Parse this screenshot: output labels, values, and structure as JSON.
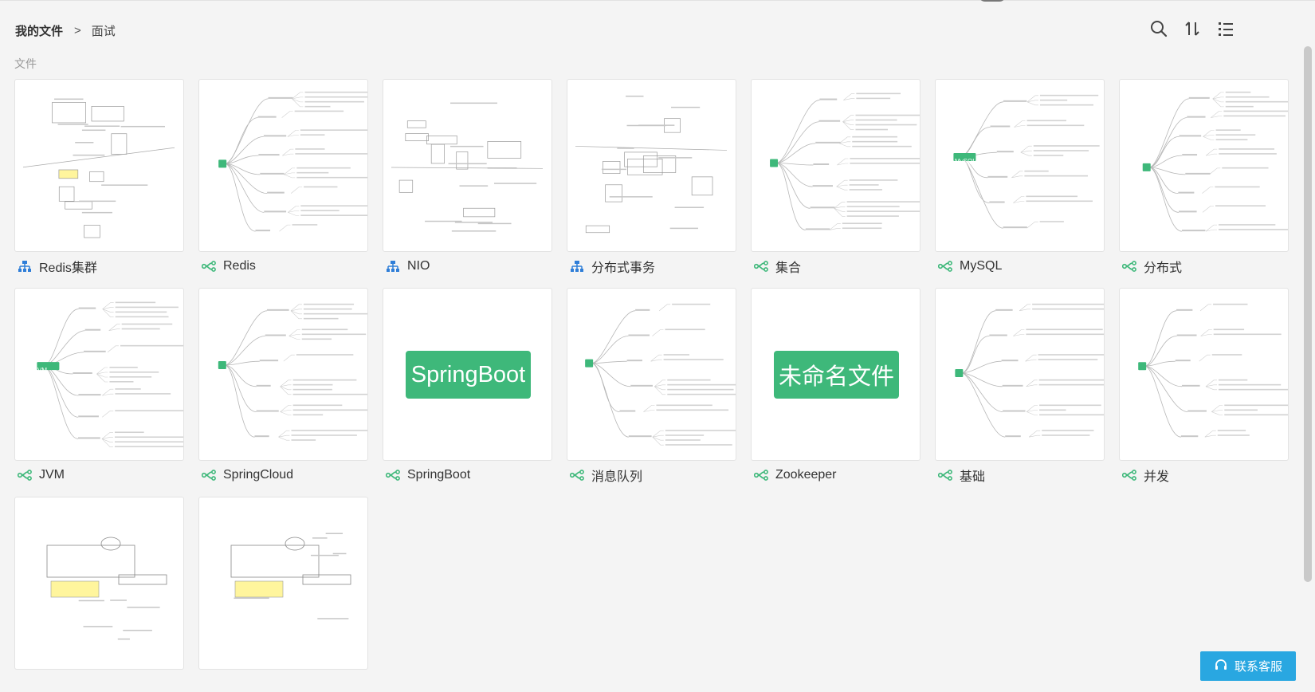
{
  "breadcrumb": {
    "root": "我的文件",
    "separator": ">",
    "current": "面试"
  },
  "section_label": "文件",
  "toolbar": {
    "icons": [
      "search-icon",
      "sort-icon",
      "list-view-icon"
    ]
  },
  "files": [
    {
      "name": "Redis集群",
      "kind": "org"
    },
    {
      "name": "Redis",
      "kind": "mind"
    },
    {
      "name": "NIO",
      "kind": "org"
    },
    {
      "name": "分布式事务",
      "kind": "org"
    },
    {
      "name": "集合",
      "kind": "mind"
    },
    {
      "name": "MySQL",
      "kind": "mind",
      "root_label": "MySQL"
    },
    {
      "name": "分布式",
      "kind": "mind"
    },
    {
      "name": "JVM",
      "kind": "mind",
      "root_label": "JVM"
    },
    {
      "name": "SpringCloud",
      "kind": "mind"
    },
    {
      "name": "SpringBoot",
      "kind": "mind",
      "banner": "SpringBoot"
    },
    {
      "name": "消息队列",
      "kind": "mind"
    },
    {
      "name": "Zookeeper",
      "kind": "mind",
      "banner": "未命名文件"
    },
    {
      "name": "基础",
      "kind": "mind"
    },
    {
      "name": "并发",
      "kind": "mind"
    },
    {
      "name": "",
      "kind": "diagram"
    },
    {
      "name": "",
      "kind": "diagram"
    }
  ],
  "support_button": {
    "label": "联系客服"
  },
  "colors": {
    "accent": "#3eb87a",
    "org_icon": "#2f7ed8",
    "mind_icon": "#3eb87a",
    "support": "#29a7e1"
  }
}
